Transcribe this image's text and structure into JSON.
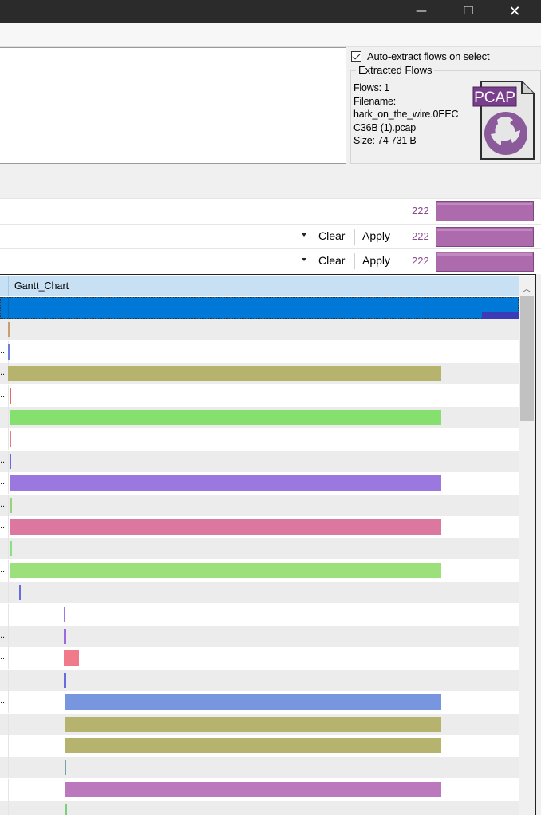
{
  "window": {
    "minimize_icon": "minimize-icon",
    "restore_icon": "restore-icon",
    "close_icon": "close-icon"
  },
  "extract": {
    "auto_extract_label": "Auto-extract flows on select",
    "auto_extract_checked": true,
    "group_title": "Extracted Flows",
    "flows_line": "Flows: 1",
    "filename_label": "Filename:",
    "filename_line1": "hark_on_the_wire.0EEC",
    "filename_line2": "C36B (1).pcap",
    "size_line": "Size: 74 731 B",
    "pcap_badge": "PCAP"
  },
  "filter_rows": [
    {
      "has_controls": false,
      "count": "222"
    },
    {
      "has_controls": true,
      "clear_label": "Clear",
      "apply_label": "Apply",
      "count": "222"
    },
    {
      "has_controls": true,
      "clear_label": "Clear",
      "apply_label": "Apply",
      "count": "222"
    }
  ],
  "grid": {
    "header": "Gantt_Chart",
    "rows": [
      {
        "selected": true,
        "dots": false,
        "color": "#3b3bb8"
      },
      {
        "dots": false,
        "color": "#c8a070"
      },
      {
        "dots": true,
        "color": "#6a7ee0"
      },
      {
        "dots": true,
        "color": "#b5b36e"
      },
      {
        "dots": true,
        "color": "#e06a6a"
      },
      {
        "dots": false,
        "color": "#86e06e"
      },
      {
        "dots": false,
        "color": "#e87a86"
      },
      {
        "dots": true,
        "color": "#6a6ae0"
      },
      {
        "dots": true,
        "color": "#9b78e0"
      },
      {
        "dots": true,
        "color": "#9bd07a"
      },
      {
        "dots": true,
        "color": "#dc78a0"
      },
      {
        "dots": false,
        "color": "#86e086"
      },
      {
        "dots": true,
        "color": "#9be07a"
      },
      {
        "dots": false,
        "color": "#6a6ae0"
      },
      {
        "dots": false,
        "color": "#a078e0"
      },
      {
        "dots": true,
        "color": "#9a6ae0"
      },
      {
        "dots": true,
        "color": "#f07a8a"
      },
      {
        "dots": false,
        "color": "#6a6ae0"
      },
      {
        "dots": true,
        "color": "#7895e0"
      },
      {
        "dots": false,
        "color": "#b5b36e"
      },
      {
        "dots": false,
        "color": "#b5b36e"
      },
      {
        "dots": false,
        "color": "#78a0b0"
      },
      {
        "dots": false,
        "color": "#bc78bc"
      },
      {
        "dots": false,
        "color": "#7ad07a"
      }
    ]
  }
}
